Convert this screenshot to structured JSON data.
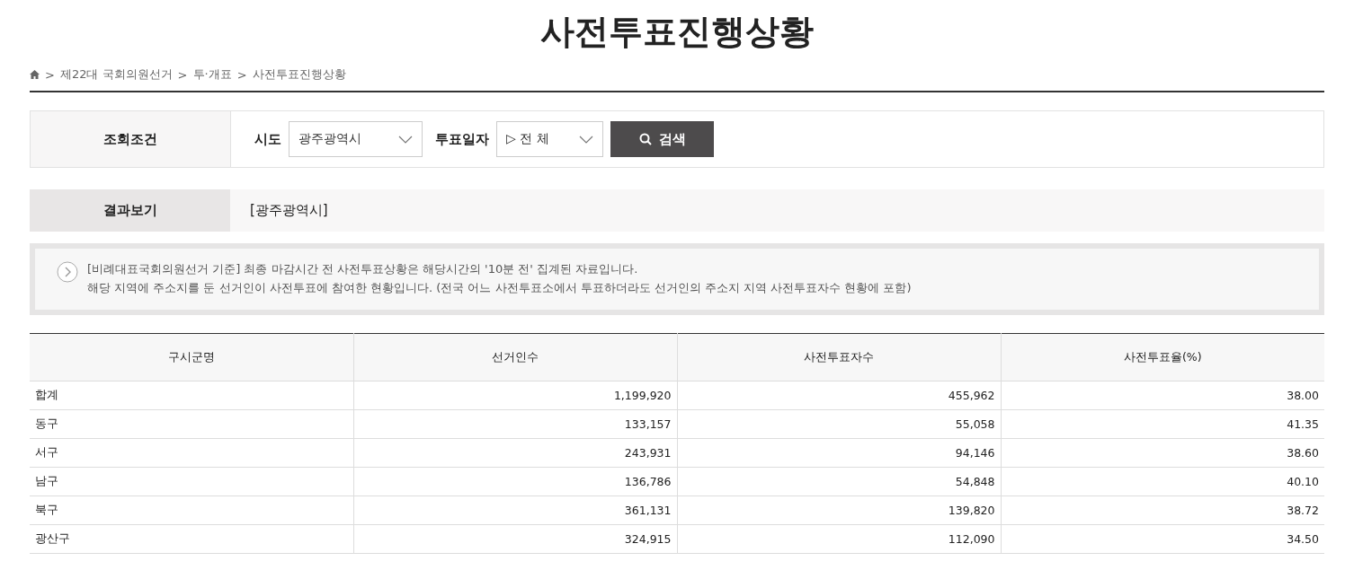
{
  "title": "사전투표진행상황",
  "breadcrumb": {
    "separator": ">",
    "items": [
      "제22대 국회의원선거",
      "투·개표",
      "사전투표진행상황"
    ]
  },
  "search": {
    "label": "조회조건",
    "fields": [
      {
        "label": "시도",
        "value": "광주광역시"
      },
      {
        "label": "투표일자",
        "value": "▷ 전 체"
      }
    ],
    "button": "검색"
  },
  "result": {
    "label": "결과보기",
    "value": "[광주광역시]"
  },
  "notice": [
    "[비례대표국회의원선거 기준] 최종 마감시간 전 사전투표상황은 해당시간의 '10분 전' 집계된 자료입니다.",
    "해당 지역에 주소지를 둔 선거인이 사전투표에 참여한 현황입니다. (전국 어느 사전투표소에서 투표하더라도 선거인의 주소지 지역 사전투표자수 현황에 포함)"
  ],
  "table": {
    "columns": [
      "구시군명",
      "선거인수",
      "사전투표자수",
      "사전투표율(%)"
    ],
    "rows": [
      [
        "합계",
        "1,199,920",
        "455,962",
        "38.00"
      ],
      [
        "동구",
        "133,157",
        "55,058",
        "41.35"
      ],
      [
        "서구",
        "243,931",
        "94,146",
        "38.60"
      ],
      [
        "남구",
        "136,786",
        "54,848",
        "40.10"
      ],
      [
        "북구",
        "361,131",
        "139,820",
        "38.72"
      ],
      [
        "광산구",
        "324,915",
        "112,090",
        "34.50"
      ]
    ]
  }
}
